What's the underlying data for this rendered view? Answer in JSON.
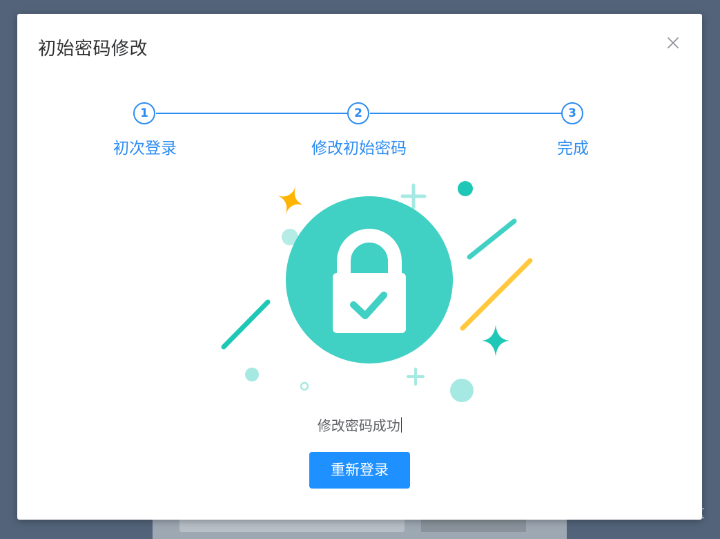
{
  "dialog": {
    "title": "初始密码修改",
    "close_icon": "close-icon"
  },
  "steps": [
    {
      "number": "1",
      "label": "初次登录"
    },
    {
      "number": "2",
      "label": "修改初始密码"
    },
    {
      "number": "3",
      "label": "完成"
    }
  ],
  "result": {
    "message": "修改密码成功",
    "button_label": "重新登录",
    "illustration_icon": "lock-check-icon"
  },
  "watermark": "@稀土掘金技术社区",
  "colors": {
    "primary": "#2d8cf0",
    "button": "#1e90ff",
    "teal": "#40d0c4",
    "yellow": "#ffc83d",
    "overlay": "#53647a"
  }
}
